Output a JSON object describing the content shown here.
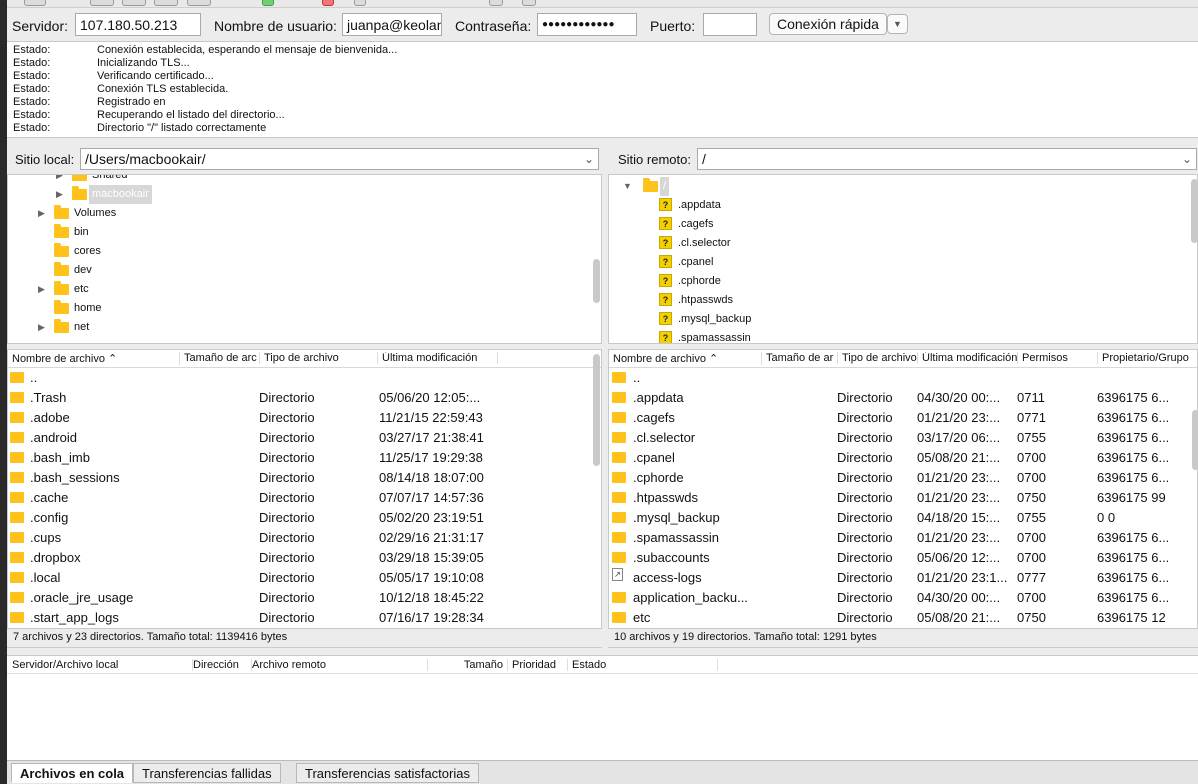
{
  "quickconnect": {
    "server_label": "Servidor:",
    "server_value": "107.180.50.213",
    "user_label": "Nombre de usuario:",
    "user_value": "juanpa@keolanu",
    "password_label": "Contraseña:",
    "password_value": "●●●●●●●●●●●●",
    "port_label": "Puerto:",
    "port_value": "",
    "connect_button": "Conexión rápida"
  },
  "log": [
    {
      "key": "Estado:",
      "msg": "Conexión establecida, esperando el mensaje de bienvenida..."
    },
    {
      "key": "Estado:",
      "msg": "Inicializando TLS..."
    },
    {
      "key": "Estado:",
      "msg": "Verificando certificado..."
    },
    {
      "key": "Estado:",
      "msg": "Conexión TLS establecida."
    },
    {
      "key": "Estado:",
      "msg": "Registrado en"
    },
    {
      "key": "Estado:",
      "msg": "Recuperando el listado del directorio..."
    },
    {
      "key": "Estado:",
      "msg": "Directorio \"/\" listado correctamente"
    }
  ],
  "local": {
    "site_label": "Sitio local:",
    "path": "/Users/macbookair/",
    "tree": [
      {
        "label": "Shared",
        "arrow": "▶",
        "level": 2
      },
      {
        "label": "macbookair",
        "arrow": "▶",
        "level": 2,
        "selected": true
      },
      {
        "label": "Volumes",
        "arrow": "▶",
        "level": 1
      },
      {
        "label": "bin",
        "arrow": "",
        "level": 1
      },
      {
        "label": "cores",
        "arrow": "",
        "level": 1
      },
      {
        "label": "dev",
        "arrow": "",
        "level": 1
      },
      {
        "label": "etc",
        "arrow": "▶",
        "level": 1
      },
      {
        "label": "home",
        "arrow": "",
        "level": 1
      },
      {
        "label": "net",
        "arrow": "▶",
        "level": 1
      }
    ],
    "columns": [
      "Nombre de archivo",
      "Tamaño de arc",
      "Tipo de archivo",
      "Última modificación"
    ],
    "files": [
      {
        "name": "..",
        "size": "",
        "type": "",
        "modified": ""
      },
      {
        "name": ".Trash",
        "size": "",
        "type": "Directorio",
        "modified": "05/06/20 12:05:..."
      },
      {
        "name": ".adobe",
        "size": "",
        "type": "Directorio",
        "modified": "11/21/15 22:59:43"
      },
      {
        "name": ".android",
        "size": "",
        "type": "Directorio",
        "modified": "03/27/17 21:38:41"
      },
      {
        "name": ".bash_imb",
        "size": "",
        "type": "Directorio",
        "modified": "11/25/17 19:29:38"
      },
      {
        "name": ".bash_sessions",
        "size": "",
        "type": "Directorio",
        "modified": "08/14/18 18:07:00"
      },
      {
        "name": ".cache",
        "size": "",
        "type": "Directorio",
        "modified": "07/07/17 14:57:36"
      },
      {
        "name": ".config",
        "size": "",
        "type": "Directorio",
        "modified": "05/02/20 23:19:51"
      },
      {
        "name": ".cups",
        "size": "",
        "type": "Directorio",
        "modified": "02/29/16 21:31:17"
      },
      {
        "name": ".dropbox",
        "size": "",
        "type": "Directorio",
        "modified": "03/29/18 15:39:05"
      },
      {
        "name": ".local",
        "size": "",
        "type": "Directorio",
        "modified": "05/05/17 19:10:08"
      },
      {
        "name": ".oracle_jre_usage",
        "size": "",
        "type": "Directorio",
        "modified": "10/12/18 18:45:22"
      },
      {
        "name": ".start_app_logs",
        "size": "",
        "type": "Directorio",
        "modified": "07/16/17 19:28:34"
      }
    ],
    "status": "7 archivos y 23 directorios. Tamaño total: 1139416 bytes"
  },
  "remote": {
    "site_label": "Sitio remoto:",
    "path": "/",
    "tree": [
      {
        "label": "/",
        "arrow": "▼",
        "icon": "folder",
        "selected": true
      },
      {
        "label": ".appdata",
        "icon": "question"
      },
      {
        "label": ".cagefs",
        "icon": "question"
      },
      {
        "label": ".cl.selector",
        "icon": "question"
      },
      {
        "label": ".cpanel",
        "icon": "question"
      },
      {
        "label": ".cphorde",
        "icon": "question"
      },
      {
        "label": ".htpasswds",
        "icon": "question"
      },
      {
        "label": ".mysql_backup",
        "icon": "question"
      },
      {
        "label": ".spamassassin",
        "icon": "question"
      }
    ],
    "columns": [
      "Nombre de archivo",
      "Tamaño de ar",
      "Tipo de archivo",
      "Última modificación",
      "Permisos",
      "Propietario/Grupo"
    ],
    "files": [
      {
        "name": "..",
        "type": "",
        "modified": "",
        "perms": "",
        "owner": ""
      },
      {
        "name": ".appdata",
        "type": "Directorio",
        "modified": "04/30/20 00:...",
        "perms": "0711",
        "owner": "6396175 6..."
      },
      {
        "name": ".cagefs",
        "type": "Directorio",
        "modified": "01/21/20 23:...",
        "perms": "0771",
        "owner": "6396175 6..."
      },
      {
        "name": ".cl.selector",
        "type": "Directorio",
        "modified": "03/17/20 06:...",
        "perms": "0755",
        "owner": "6396175 6..."
      },
      {
        "name": ".cpanel",
        "type": "Directorio",
        "modified": "05/08/20 21:...",
        "perms": "0700",
        "owner": "6396175 6..."
      },
      {
        "name": ".cphorde",
        "type": "Directorio",
        "modified": "01/21/20 23:...",
        "perms": "0700",
        "owner": "6396175 6..."
      },
      {
        "name": ".htpasswds",
        "type": "Directorio",
        "modified": "01/21/20 23:...",
        "perms": "0750",
        "owner": "6396175 99"
      },
      {
        "name": ".mysql_backup",
        "type": "Directorio",
        "modified": "04/18/20 15:...",
        "perms": "0755",
        "owner": "0 0"
      },
      {
        "name": ".spamassassin",
        "type": "Directorio",
        "modified": "01/21/20 23:...",
        "perms": "0700",
        "owner": "6396175 6..."
      },
      {
        "name": ".subaccounts",
        "type": "Directorio",
        "modified": "05/06/20 12:...",
        "perms": "0700",
        "owner": "6396175 6..."
      },
      {
        "name": "access-logs",
        "type": "Directorio",
        "modified": "01/21/20 23:1...",
        "perms": "0777",
        "owner": "6396175 6...",
        "link": true
      },
      {
        "name": "application_backu...",
        "type": "Directorio",
        "modified": "04/30/20 00:...",
        "perms": "0700",
        "owner": "6396175 6..."
      },
      {
        "name": "etc",
        "type": "Directorio",
        "modified": "05/08/20 21:...",
        "perms": "0750",
        "owner": "6396175 12"
      }
    ],
    "status": "10 archivos y 19 directorios. Tamaño total: 1291 bytes"
  },
  "queue": {
    "columns": [
      "Servidor/Archivo local",
      "Dirección",
      "Archivo remoto",
      "Tamaño",
      "Prioridad",
      "Estado"
    ]
  },
  "tabs": [
    "Archivos en cola",
    "Transferencias fallidas",
    "Transferencias satisfactorias"
  ]
}
